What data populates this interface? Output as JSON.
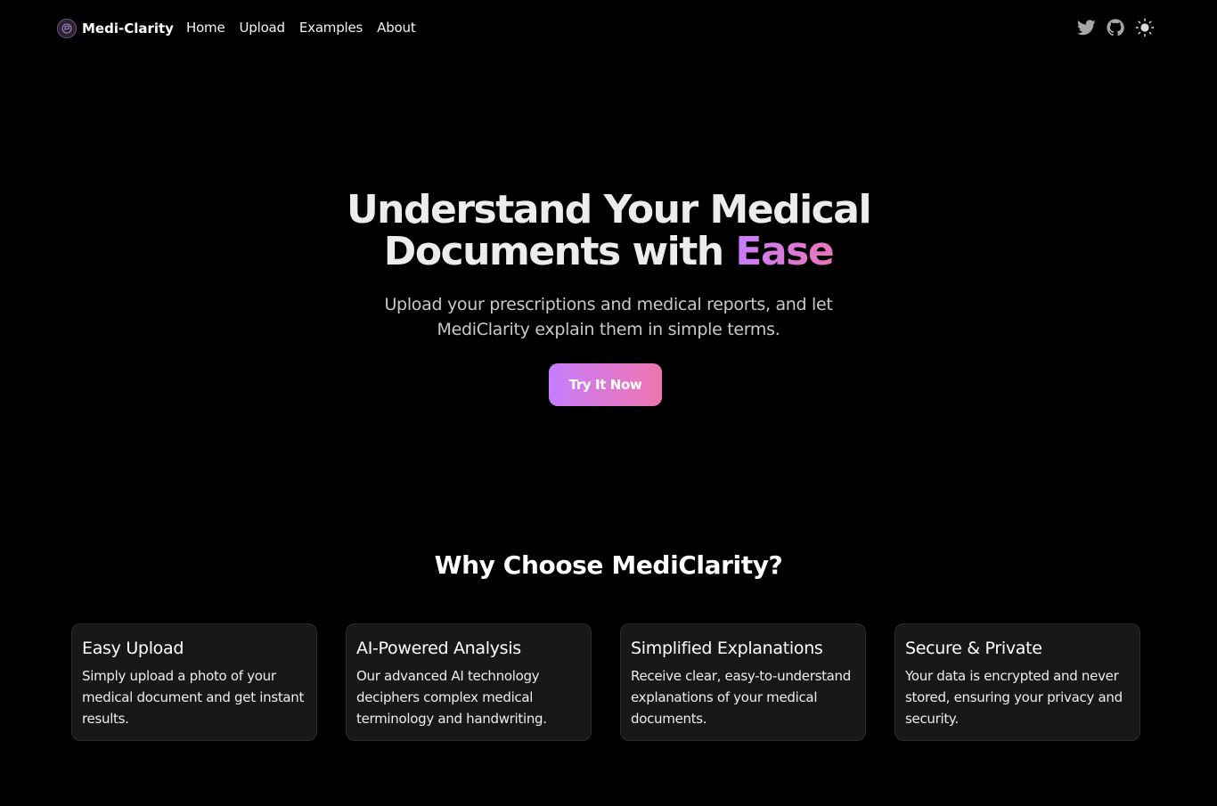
{
  "nav": {
    "brand": "Medi-Clarity",
    "links": [
      "Home",
      "Upload",
      "Examples",
      "About"
    ],
    "icons": [
      "twitter-icon",
      "github-icon",
      "sun-icon"
    ]
  },
  "hero": {
    "title_main": "Understand Your Medical Documents with ",
    "title_accent": "Ease",
    "subtitle": "Upload your prescriptions and medical reports, and let MediClarity explain them in simple terms.",
    "cta_label": "Try It Now"
  },
  "features": {
    "heading": "Why Choose MediClarity?",
    "items": [
      {
        "title": "Easy Upload",
        "description": "Simply upload a photo of your medical document and get instant results."
      },
      {
        "title": "AI-Powered Analysis",
        "description": "Our advanced AI technology deciphers complex medical terminology and handwriting."
      },
      {
        "title": "Simplified Explanations",
        "description": "Receive clear, easy-to-understand explanations of your medical documents."
      },
      {
        "title": "Secure & Private",
        "description": "Your data is encrypted and never stored, ensuring your privacy and security."
      }
    ]
  },
  "colors": {
    "background": "#000000",
    "card_background": "#18181b",
    "accent_start": "#c77dfd",
    "accent_end": "#ef75ae"
  }
}
